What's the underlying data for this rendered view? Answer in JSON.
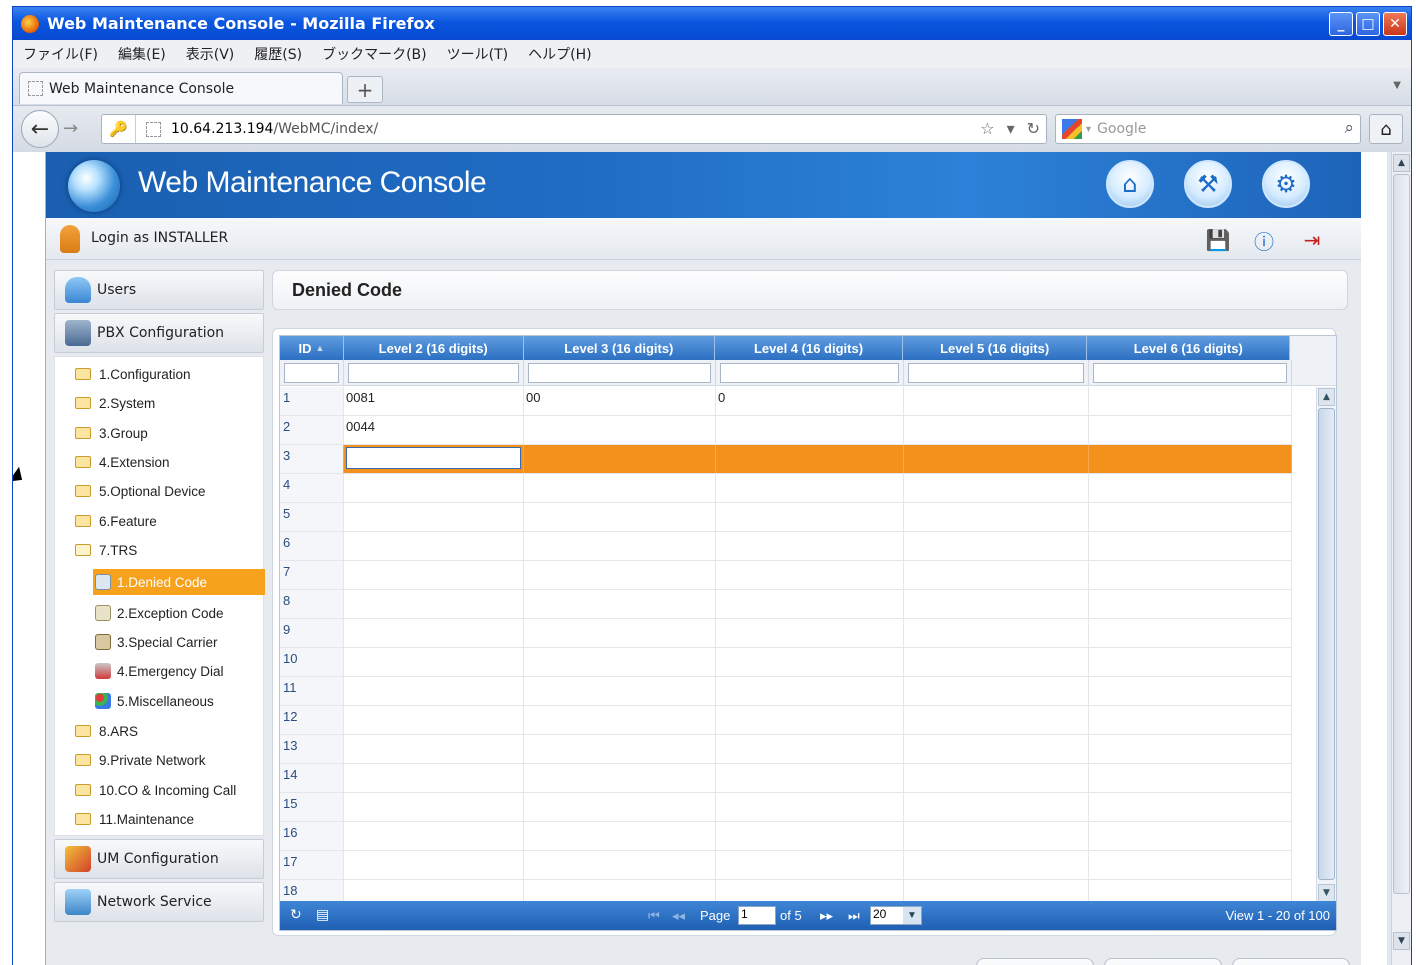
{
  "window": {
    "title": "Web Maintenance Console - Mozilla Firefox"
  },
  "menubar": [
    "ファイル(F)",
    "編集(E)",
    "表示(V)",
    "履歴(S)",
    "ブックマーク(B)",
    "ツール(T)",
    "ヘルプ(H)"
  ],
  "tab": {
    "label": "Web Maintenance Console",
    "new_tab": "+"
  },
  "nav": {
    "url_host": "10.64.213.194",
    "url_path": "/WebMC/index/",
    "search_placeholder": "Google"
  },
  "app": {
    "title": "Web Maintenance Console",
    "login": "Login as INSTALLER"
  },
  "sidebar": {
    "sections": {
      "users": "Users",
      "pbx": "PBX Configuration",
      "um": "UM Configuration",
      "network": "Network Service"
    },
    "tree": [
      "1.Configuration",
      "2.System",
      "3.Group",
      "4.Extension",
      "5.Optional Device",
      "6.Feature",
      "7.TRS",
      "1.Denied Code",
      "2.Exception Code",
      "3.Special Carrier",
      "4.Emergency Dial",
      "5.Miscellaneous",
      "8.ARS",
      "9.Private Network",
      "10.CO & Incoming Call",
      "11.Maintenance"
    ]
  },
  "page": {
    "title": "Denied Code"
  },
  "grid": {
    "columns": [
      "ID",
      "Level 2 (16 digits)",
      "Level 3 (16 digits)",
      "Level 4 (16 digits)",
      "Level 5 (16 digits)",
      "Level 6 (16 digits)"
    ],
    "rows": [
      [
        "1",
        "0081",
        "00",
        "0",
        "",
        ""
      ],
      [
        "2",
        "0044",
        "",
        "",
        "",
        ""
      ],
      [
        "3",
        "",
        "",
        "",
        "",
        ""
      ],
      [
        "4",
        "",
        "",
        "",
        "",
        ""
      ],
      [
        "5",
        "",
        "",
        "",
        "",
        ""
      ],
      [
        "6",
        "",
        "",
        "",
        "",
        ""
      ],
      [
        "7",
        "",
        "",
        "",
        "",
        ""
      ],
      [
        "8",
        "",
        "",
        "",
        "",
        ""
      ],
      [
        "9",
        "",
        "",
        "",
        "",
        ""
      ],
      [
        "10",
        "",
        "",
        "",
        "",
        ""
      ],
      [
        "11",
        "",
        "",
        "",
        "",
        ""
      ],
      [
        "12",
        "",
        "",
        "",
        "",
        ""
      ],
      [
        "13",
        "",
        "",
        "",
        "",
        ""
      ],
      [
        "14",
        "",
        "",
        "",
        "",
        ""
      ],
      [
        "15",
        "",
        "",
        "",
        "",
        ""
      ],
      [
        "16",
        "",
        "",
        "",
        "",
        ""
      ],
      [
        "17",
        "",
        "",
        "",
        "",
        ""
      ],
      [
        "18",
        "",
        "",
        "",
        "",
        ""
      ]
    ],
    "selected_row": 3,
    "pager": {
      "page_label": "Page",
      "page_value": "1",
      "of_label": "of 5",
      "page_size": "20",
      "view_text": "View 1 - 20 of 100"
    }
  },
  "colors": {
    "accent": "#f2921c",
    "header_blue": "#1f6cc4"
  }
}
